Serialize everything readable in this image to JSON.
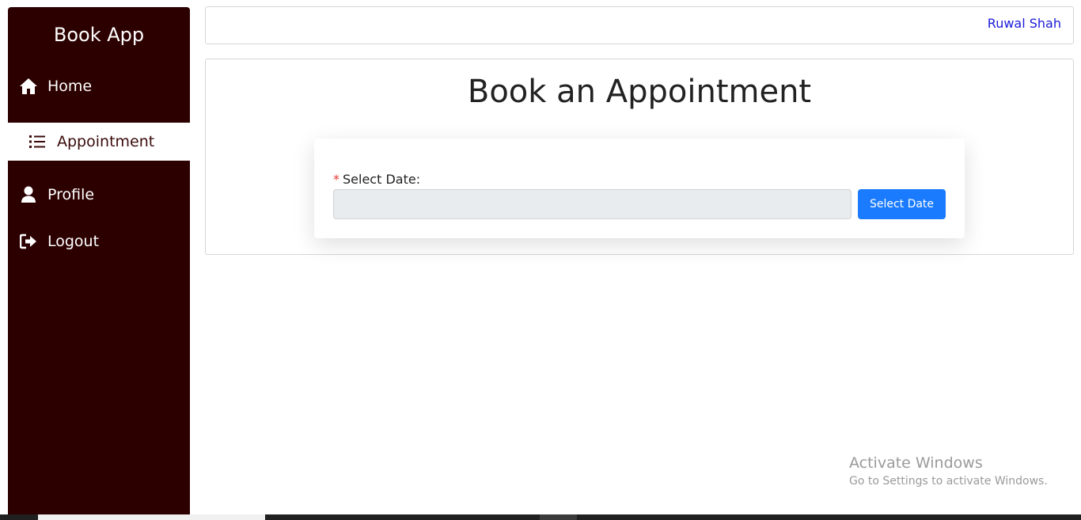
{
  "sidebar": {
    "brand": "Book App",
    "items": [
      {
        "label": "Home",
        "icon": "home-icon",
        "active": false
      },
      {
        "label": "Appointment",
        "icon": "list-icon",
        "active": true
      },
      {
        "label": "Profile",
        "icon": "user-icon",
        "active": false
      },
      {
        "label": "Logout",
        "icon": "logout-icon",
        "active": false
      }
    ]
  },
  "header": {
    "user_name": "Ruwal Shah"
  },
  "main": {
    "title": "Book an Appointment",
    "form": {
      "required_marker": "*",
      "date_label": "Select Date:",
      "date_value": "",
      "button_label": "Select Date"
    }
  },
  "watermark": {
    "title": "Activate Windows",
    "subtitle": "Go to Settings to activate Windows."
  },
  "colors": {
    "sidebar_bg": "#2d0000",
    "user_link": "#1a1adb",
    "primary_button": "#1a7bff",
    "required_star": "#e53935",
    "input_bg": "#e9ecef"
  }
}
